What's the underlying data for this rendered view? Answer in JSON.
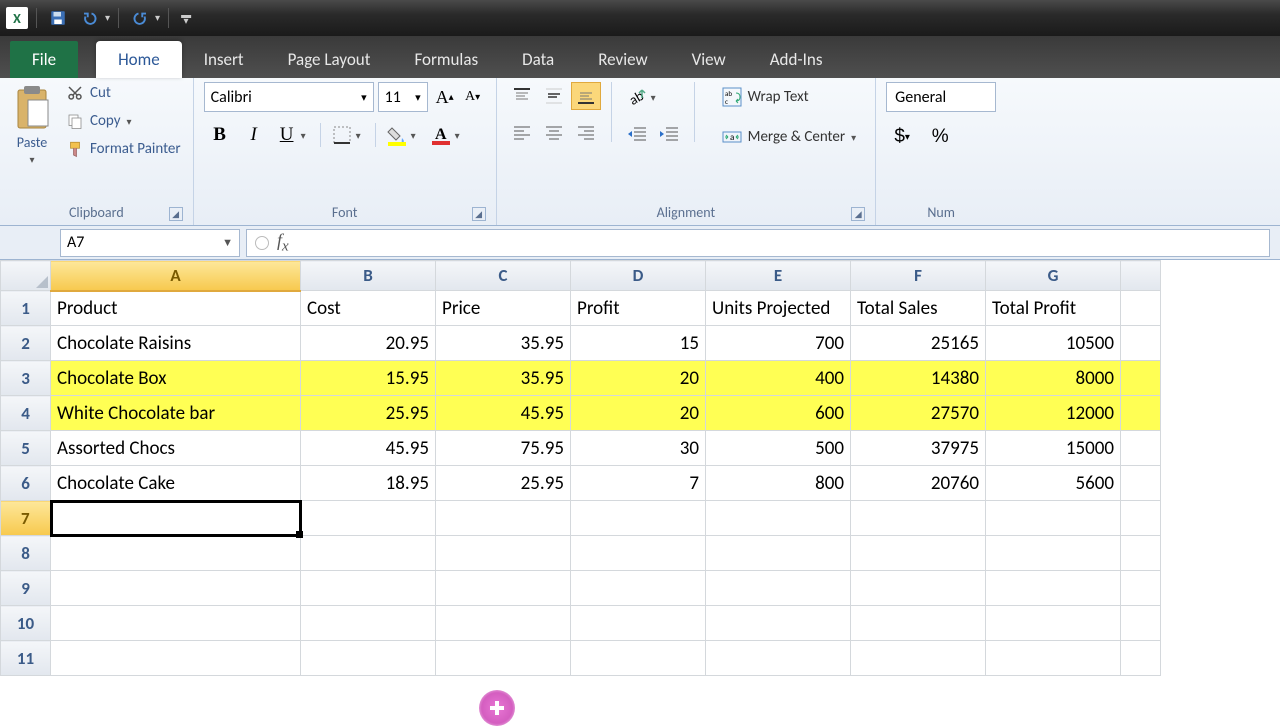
{
  "qat": {
    "save": "Save",
    "undo": "Undo",
    "redo": "Redo"
  },
  "tabs": {
    "file": "File",
    "home": "Home",
    "insert": "Insert",
    "pageLayout": "Page Layout",
    "formulas": "Formulas",
    "data": "Data",
    "review": "Review",
    "view": "View",
    "addins": "Add-Ins"
  },
  "clipboard": {
    "paste": "Paste",
    "cut": "Cut",
    "copy": "Copy",
    "formatPainter": "Format Painter",
    "group": "Clipboard"
  },
  "font": {
    "name": "Calibri",
    "size": "11",
    "group": "Font"
  },
  "alignment": {
    "wrap": "Wrap Text",
    "merge": "Merge & Center",
    "group": "Alignment"
  },
  "number": {
    "format": "General",
    "group": "Num"
  },
  "nameBox": "A7",
  "columns": [
    "A",
    "B",
    "C",
    "D",
    "E",
    "F",
    "G"
  ],
  "headers": [
    "Product",
    "Cost",
    "Price",
    "Profit",
    "Units Projected",
    "Total Sales",
    "Total Profit"
  ],
  "rows": [
    {
      "n": 2,
      "hl": false,
      "c": [
        "Chocolate Raisins",
        "20.95",
        "35.95",
        "15",
        "700",
        "25165",
        "10500"
      ]
    },
    {
      "n": 3,
      "hl": true,
      "c": [
        "Chocolate Box",
        "15.95",
        "35.95",
        "20",
        "400",
        "14380",
        "8000"
      ]
    },
    {
      "n": 4,
      "hl": true,
      "c": [
        "White Chocolate bar",
        "25.95",
        "45.95",
        "20",
        "600",
        "27570",
        "12000"
      ]
    },
    {
      "n": 5,
      "hl": false,
      "c": [
        "Assorted Chocs",
        "45.95",
        "75.95",
        "30",
        "500",
        "37975",
        "15000"
      ]
    },
    {
      "n": 6,
      "hl": false,
      "c": [
        "Chocolate Cake",
        "18.95",
        "25.95",
        "7",
        "800",
        "20760",
        "5600"
      ]
    }
  ],
  "selectedRow": 7,
  "emptyRows": [
    7,
    8,
    9,
    10,
    11
  ]
}
